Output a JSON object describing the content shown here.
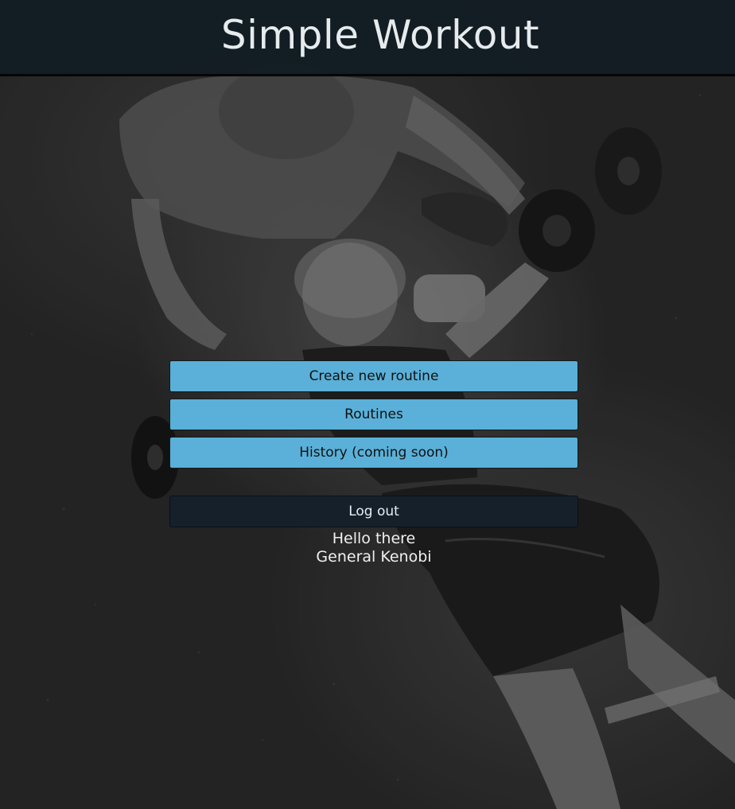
{
  "header": {
    "title": "Simple Workout"
  },
  "menu": {
    "create_label": "Create new routine",
    "routines_label": "Routines",
    "history_label": "History (coming soon)",
    "logout_label": "Log out"
  },
  "greeting": {
    "line1": "Hello there",
    "line2": "General Kenobi"
  },
  "colors": {
    "header_bg": "#131d24",
    "button_primary": "#5ab0d8",
    "button_dark": "#15202a"
  }
}
